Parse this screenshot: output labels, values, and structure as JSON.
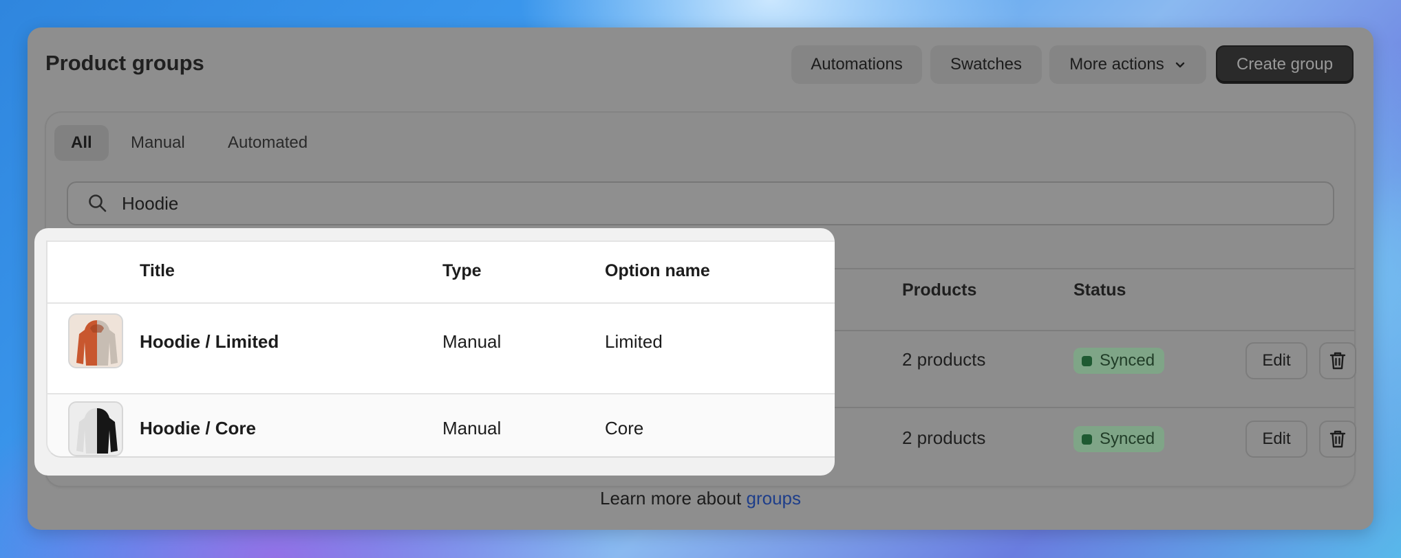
{
  "page": {
    "title": "Product groups",
    "header_buttons": {
      "automations": "Automations",
      "swatches": "Swatches",
      "more_actions": "More actions",
      "create_group": "Create group"
    },
    "tabs": [
      {
        "label": "All",
        "active": true
      },
      {
        "label": "Manual",
        "active": false
      },
      {
        "label": "Automated",
        "active": false
      }
    ],
    "search": {
      "value": "Hoodie",
      "icon": "search-icon"
    },
    "table": {
      "columns": [
        "Title",
        "Type",
        "Option name",
        "Products",
        "Status"
      ],
      "rows": [
        {
          "title": "Hoodie / Limited",
          "type": "Manual",
          "option_name": "Limited",
          "products": "2 products",
          "status": "Synced",
          "edit_label": "Edit",
          "thumbnail": "orange-beige-hoodie"
        },
        {
          "title": "Hoodie / Core",
          "type": "Manual",
          "option_name": "Core",
          "products": "2 products",
          "status": "Synced",
          "edit_label": "Edit",
          "thumbnail": "white-black-hoodie"
        }
      ]
    },
    "footer": {
      "text": "Learn more about ",
      "link": "groups"
    }
  },
  "colors": {
    "primary_button": "#2a2a2a",
    "status_synced_bg": "#7fa587",
    "status_synced_dot": "#1f5a32",
    "link": "#1e3e8a"
  }
}
